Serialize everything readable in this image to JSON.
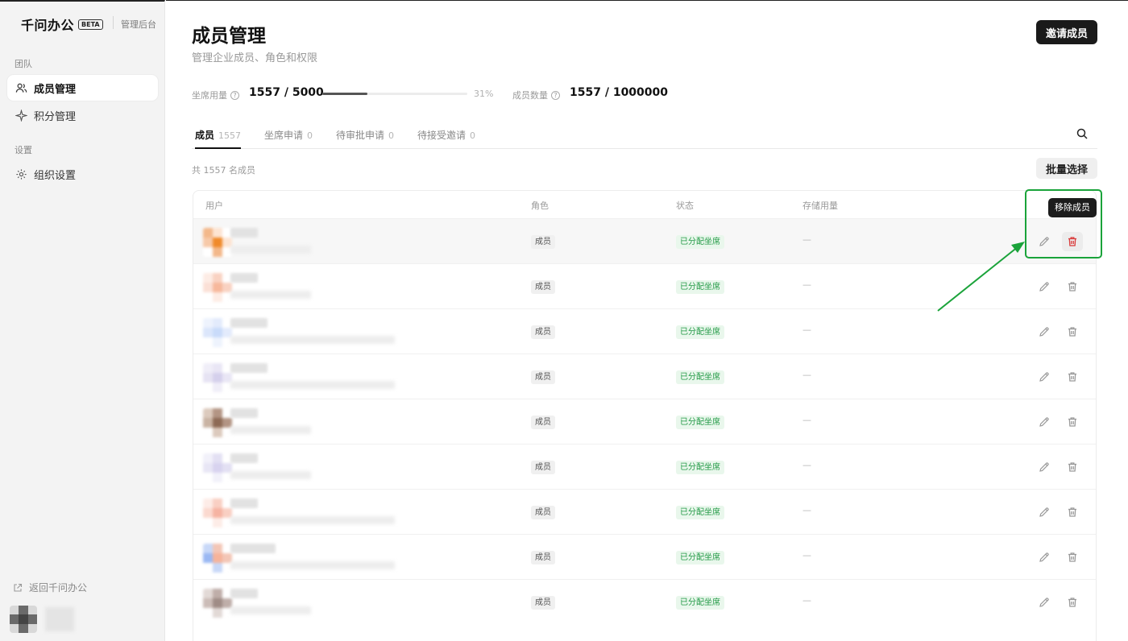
{
  "app": {
    "name": "千问办公",
    "badge": "BETA",
    "section": "管理后台"
  },
  "sidebar": {
    "groups": [
      {
        "label": "团队"
      },
      {
        "label": "设置"
      }
    ],
    "items": [
      {
        "label": "成员管理",
        "icon": "users-icon",
        "active": true
      },
      {
        "label": "积分管理",
        "icon": "sparkle-icon",
        "active": false
      },
      {
        "label": "组织设置",
        "icon": "gear-icon",
        "active": false
      }
    ],
    "back_label": "返回千问办公"
  },
  "header": {
    "title": "成员管理",
    "subtitle": "管理企业成员、角色和权限",
    "invite_label": "邀请成员"
  },
  "stats": {
    "seat_label": "坐席用量",
    "seat_value": "1557 / 5000",
    "seat_progress": 0.31,
    "seat_pct_label": "31%",
    "member_label": "成员数量",
    "member_value": "1557 / 1000000"
  },
  "tabs": [
    {
      "label": "成员",
      "count": "1557",
      "active": true
    },
    {
      "label": "坐席申请",
      "count": "0",
      "active": false
    },
    {
      "label": "待审批申请",
      "count": "0",
      "active": false
    },
    {
      "label": "待接受邀请",
      "count": "0",
      "active": false
    }
  ],
  "list": {
    "total_label": "共 1557 名成员",
    "batch_label": "批量选择",
    "columns": [
      "用户",
      "角色",
      "状态",
      "存储用量"
    ],
    "rows": [
      {
        "role": "成员",
        "status": "已分配坐席",
        "storage": "—"
      },
      {
        "role": "成员",
        "status": "已分配坐席",
        "storage": "—"
      },
      {
        "role": "成员",
        "status": "已分配坐席",
        "storage": "—"
      },
      {
        "role": "成员",
        "status": "已分配坐席",
        "storage": "—"
      },
      {
        "role": "成员",
        "status": "已分配坐席",
        "storage": "—"
      },
      {
        "role": "成员",
        "status": "已分配坐席",
        "storage": "—"
      },
      {
        "role": "成员",
        "status": "已分配坐席",
        "storage": "—"
      },
      {
        "role": "成员",
        "status": "已分配坐席",
        "storage": "—"
      },
      {
        "role": "成员",
        "status": "已分配坐席",
        "storage": "—"
      }
    ]
  },
  "tooltip": {
    "label": "移除成员"
  },
  "colors": {
    "accent": "#1a1a1a",
    "status_green": "#239a46",
    "delete_red": "#d93a3a",
    "annotation_green": "#1aa33a"
  }
}
